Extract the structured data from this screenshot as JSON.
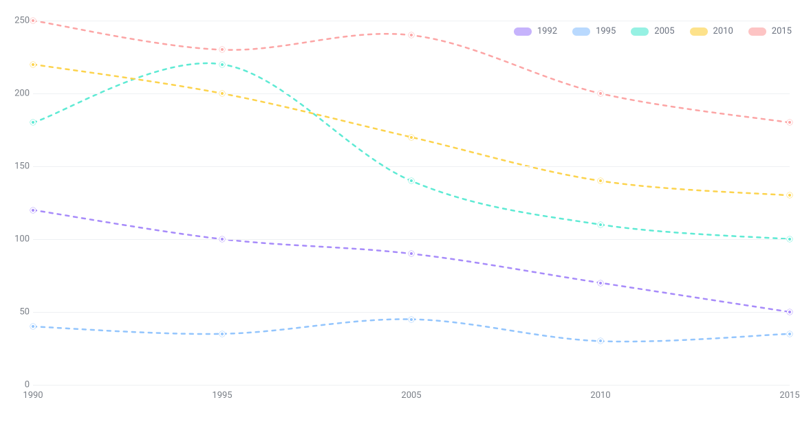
{
  "chart_data": {
    "type": "line",
    "title": "",
    "xlabel": "",
    "ylabel": "",
    "ylim": [
      0,
      250
    ],
    "y_ticks": [
      0,
      50,
      100,
      150,
      200,
      250
    ],
    "categories": [
      "1990",
      "1995",
      "2005",
      "2010",
      "2015"
    ],
    "series": [
      {
        "name": "1992",
        "color": "#a78bfa",
        "values": [
          120,
          100,
          90,
          70,
          50
        ]
      },
      {
        "name": "1995",
        "color": "#93c5fd",
        "values": [
          40,
          35,
          45,
          30,
          35
        ]
      },
      {
        "name": "2005",
        "color": "#5eead4",
        "values": [
          180,
          220,
          140,
          110,
          100
        ]
      },
      {
        "name": "2010",
        "color": "#fcd34d",
        "values": [
          220,
          200,
          170,
          140,
          130
        ]
      },
      {
        "name": "2015",
        "color": "#fca5a5",
        "values": [
          250,
          230,
          240,
          200,
          180
        ]
      }
    ],
    "line_style": "dashed",
    "legend_position": "top-right",
    "grid": true
  }
}
